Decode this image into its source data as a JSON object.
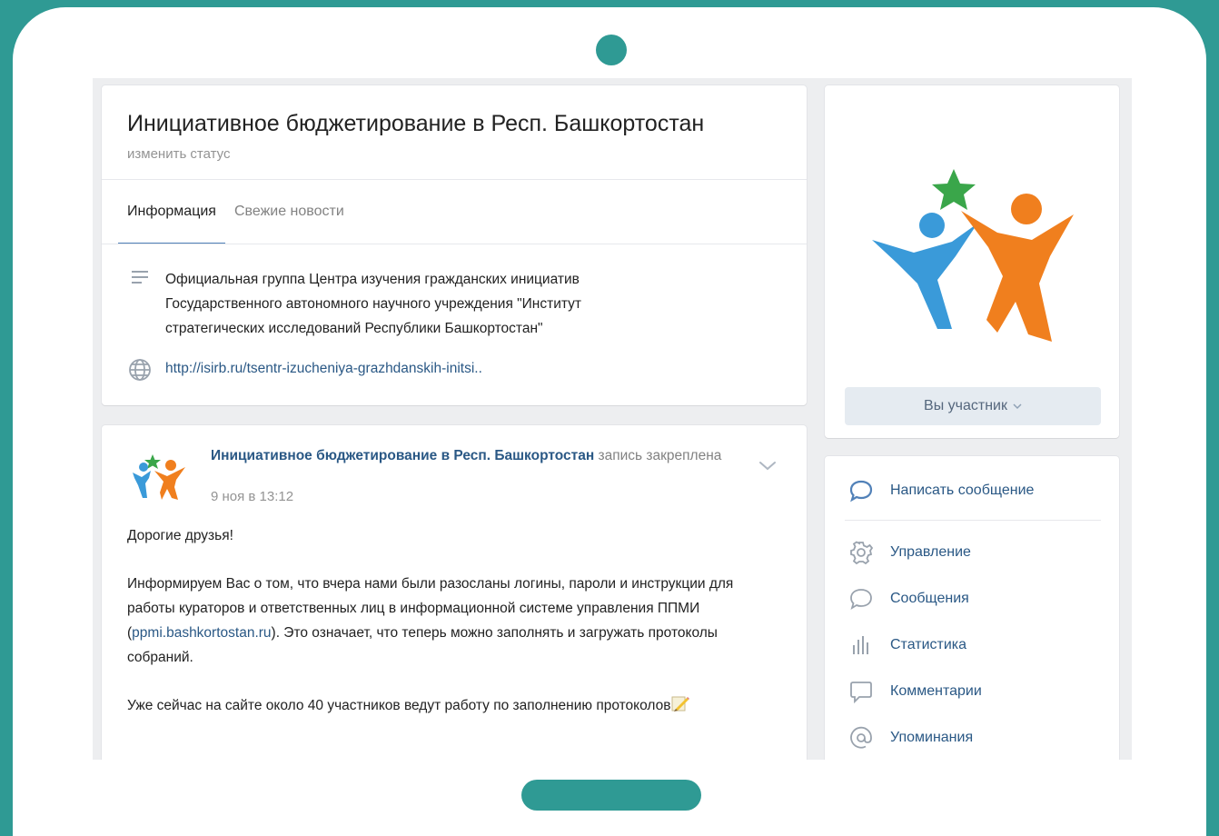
{
  "group": {
    "title": "Инициативное бюджетирование в Респ. Башкортостан",
    "status_link": "изменить статус",
    "tabs": [
      {
        "label": "Информация",
        "active": true
      },
      {
        "label": "Свежие новости",
        "active": false
      }
    ],
    "description_lines": [
      "Официальная группа Центра изучения гражданских инициатив",
      "Государственного автономного научного учреждения \"Институт",
      "стратегических исследований Республики Башкортостан\""
    ],
    "website": "http://isirb.ru/tsentr-izucheniya-grazhdanskih-initsi.."
  },
  "post": {
    "author": "Инициативное бюджетирование в Респ. Башкортостан",
    "pinned_note": "запись закреплена",
    "date": "9 ноя в 13:12",
    "greeting": "Дорогие друзья!",
    "para1_before_link": "Информируем Вас о том, что вчера нами были разосланы логины, пароли и инструкции для работы кураторов и ответственных лиц в информационной системе управления ППМИ (",
    "para1_link": "ppmi.bashkortostan.ru",
    "para1_after_link": "). Это означает, что теперь можно заполнять и загружать протоколы собраний.",
    "para2": "Уже сейчас на сайте около 40 участников ведут работу по заполнению протоколов"
  },
  "sidebar": {
    "member_button": "Вы участник",
    "write_message": "Написать сообщение",
    "menu": [
      {
        "label": "Управление",
        "icon": "gear-icon"
      },
      {
        "label": "Сообщения",
        "icon": "message-icon"
      },
      {
        "label": "Статистика",
        "icon": "stats-icon"
      },
      {
        "label": "Комментарии",
        "icon": "comment-icon"
      },
      {
        "label": "Упоминания",
        "icon": "at-icon"
      }
    ]
  },
  "colors": {
    "frame": "#2f9a94",
    "link": "#2a5885",
    "accent": "#5181b8",
    "logo_blue": "#3a9ad9",
    "logo_orange": "#f07f1e",
    "logo_green": "#3aa64a"
  }
}
